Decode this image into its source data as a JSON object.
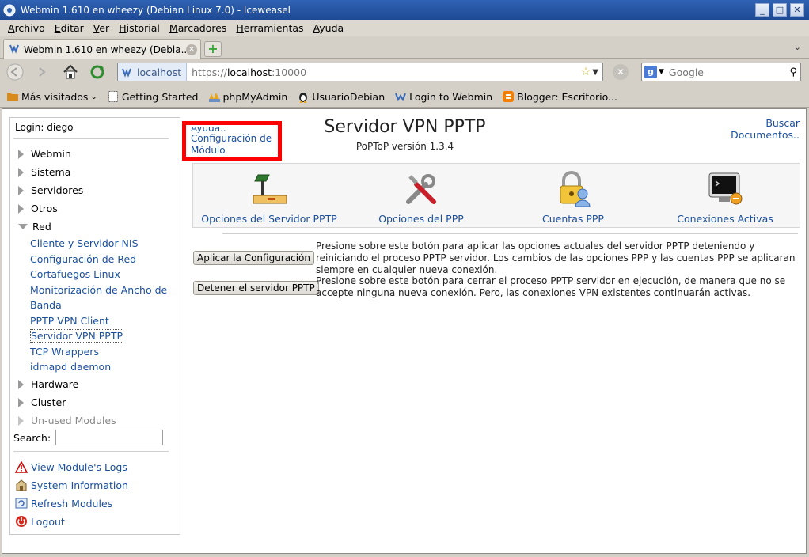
{
  "window": {
    "title": "Webmin 1.610 en wheezy (Debian Linux 7.0) - Iceweasel",
    "buttons": [
      "_",
      "□",
      "✕"
    ]
  },
  "menu": [
    {
      "label": "Archivo"
    },
    {
      "label": "Editar"
    },
    {
      "label": "Ver"
    },
    {
      "label": "Historial"
    },
    {
      "label": "Marcadores"
    },
    {
      "label": "Herramientas"
    },
    {
      "label": "Ayuda"
    }
  ],
  "tab": {
    "label": "Webmin 1.610 en wheezy (Debia..."
  },
  "navbar": {
    "site_identity": "localhost",
    "url_scheme": "https://",
    "url_host": "localhost",
    "url_port": ":10000",
    "search_placeholder": "Google"
  },
  "bookmarks": [
    {
      "label": "Más visitados",
      "icon": "folder-icon",
      "has_dropdown": true
    },
    {
      "label": "Getting Started",
      "icon": "page-icon"
    },
    {
      "label": "phpMyAdmin",
      "icon": "pma-icon"
    },
    {
      "label": "UsuarioDebian",
      "icon": "tux-icon"
    },
    {
      "label": "Login to Webmin",
      "icon": "webmin-icon"
    },
    {
      "label": "Blogger: Escritorio...",
      "icon": "blogger-icon"
    }
  ],
  "sidebar": {
    "login": "Login: diego",
    "categories": [
      {
        "label": "Webmin"
      },
      {
        "label": "Sistema"
      },
      {
        "label": "Servidores"
      },
      {
        "label": "Otros"
      },
      {
        "label": "Red"
      }
    ],
    "red_items": [
      {
        "label": "Cliente y Servidor NIS"
      },
      {
        "label": "Configuración de Red"
      },
      {
        "label": "Cortafuegos Linux"
      },
      {
        "label": "Monitorización de Ancho de Banda"
      },
      {
        "label": "PPTP VPN Client"
      },
      {
        "label": "Servidor VPN PPTP"
      },
      {
        "label": "TCP Wrappers"
      },
      {
        "label": "idmapd daemon"
      }
    ],
    "more_categories": [
      {
        "label": "Hardware"
      },
      {
        "label": "Cluster"
      },
      {
        "label": "Un-used Modules"
      }
    ],
    "search_label": "Search:",
    "links": [
      {
        "label": "View Module's Logs",
        "icon": "warning-icon"
      },
      {
        "label": "System Information",
        "icon": "system-info-icon"
      },
      {
        "label": "Refresh Modules",
        "icon": "refresh-icon"
      },
      {
        "label": "Logout",
        "icon": "power-icon"
      }
    ]
  },
  "main": {
    "help_link_top": "Ayuda..",
    "module_config_line1": "Configuración de",
    "module_config_line2": "Módulo",
    "title": "Servidor VPN PPTP",
    "subtitle": "PoPToP versión 1.3.4",
    "top_right": [
      "Buscar",
      "Documentos.."
    ],
    "icons": [
      {
        "label": "Opciones del Servidor PPTP",
        "icon": "desk-lamp-icon"
      },
      {
        "label": "Opciones del PPP",
        "icon": "tools-icon"
      },
      {
        "label": "Cuentas PPP",
        "icon": "lock-user-icon"
      },
      {
        "label": "Conexiones Activas",
        "icon": "monitor-icon"
      }
    ],
    "actions": [
      {
        "button": "Aplicar la Configuración",
        "description": "Presione sobre este botón para aplicar las opciones actuales del servidor PPTP deteniendo y reiniciando el proceso PPTP servidor. Los cambios de las opciones PPP y las cuentas PPP se aplicaran siempre en cualquier nueva conexión."
      },
      {
        "button": "Detener el servidor PPTP",
        "description": "Presione sobre este botón para cerrar el proceso PPTP servidor en ejecución, de manera que no se accepte ninguna nueva conexión. Pero, las conexiones VPN existentes continuarán activas."
      }
    ]
  },
  "colors": {
    "link": "#1a4f9c",
    "highlight": "#ff0000"
  }
}
